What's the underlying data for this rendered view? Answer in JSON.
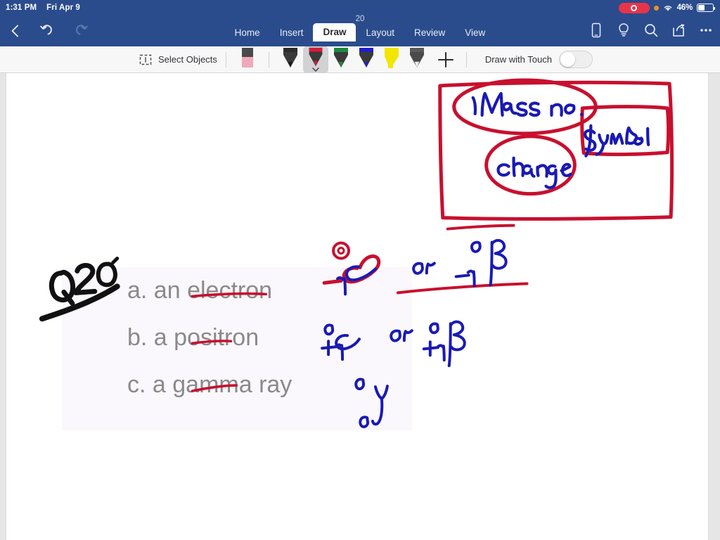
{
  "statusbar": {
    "time": "1:31 PM",
    "date": "Fri Apr 9",
    "battery_percent": "46%",
    "icons": [
      "screen-recording-pill",
      "orange-privacy-dot",
      "wifi-icon",
      "battery-icon"
    ]
  },
  "header": {
    "doc_title": "20",
    "back_label": "Back",
    "undo_label": "Undo",
    "redo_label": "Redo",
    "tabs": [
      {
        "label": "Home",
        "active": false
      },
      {
        "label": "Insert",
        "active": false
      },
      {
        "label": "Draw",
        "active": true
      },
      {
        "label": "Layout",
        "active": false
      },
      {
        "label": "Review",
        "active": false
      },
      {
        "label": "View",
        "active": false
      }
    ],
    "right_icons": [
      "mobile-view-icon",
      "tell-me-lightbulb-icon",
      "search-icon",
      "share-icon",
      "more-ellipsis-icon"
    ]
  },
  "toolbar": {
    "select_objects_label": "Select Objects",
    "draw_with_touch_label": "Draw with Touch",
    "draw_with_touch_on": false,
    "add_pen_label": "+",
    "pens": [
      {
        "name": "eraser",
        "color": "#efa9bb",
        "body": "#3a3a3a",
        "selected": false,
        "type": "eraser"
      },
      {
        "name": "pen-black",
        "color": "#1a1a1a",
        "body": "#3a3a3a",
        "selected": false,
        "type": "pen"
      },
      {
        "name": "pen-red",
        "color": "#d81b3c",
        "body": "#3a3a3a",
        "selected": true,
        "type": "pen"
      },
      {
        "name": "pen-green",
        "color": "#1e8a3c",
        "body": "#3a3a3a",
        "selected": false,
        "type": "pen"
      },
      {
        "name": "pen-blue",
        "color": "#2020c8",
        "body": "#3a3a3a",
        "selected": false,
        "type": "pen"
      },
      {
        "name": "highlighter-yellow",
        "color": "#f2e600",
        "body": "#f2e600",
        "selected": false,
        "type": "highlighter"
      },
      {
        "name": "pen-white",
        "color": "#e8e8e8",
        "body": "#3a3a3a",
        "selected": false,
        "type": "pen"
      }
    ]
  },
  "document": {
    "question_label": "Q20",
    "choices": [
      {
        "id": "a",
        "text": "a. an electron",
        "annotation": "0 -1 e  or  0 -1 β"
      },
      {
        "id": "b",
        "text": "b. a positron",
        "annotation": "0 +1 e  or  0 +1 β"
      },
      {
        "id": "c",
        "text": "c. a gamma ray",
        "annotation": "0 0 γ"
      }
    ],
    "ink_notes": {
      "box_terms": [
        "Mass no.",
        "Symbol",
        "change"
      ],
      "connector_word": "or"
    },
    "ink_colors": {
      "red": "#c8102e",
      "blue": "#1a1ab4",
      "black": "#111111"
    }
  }
}
